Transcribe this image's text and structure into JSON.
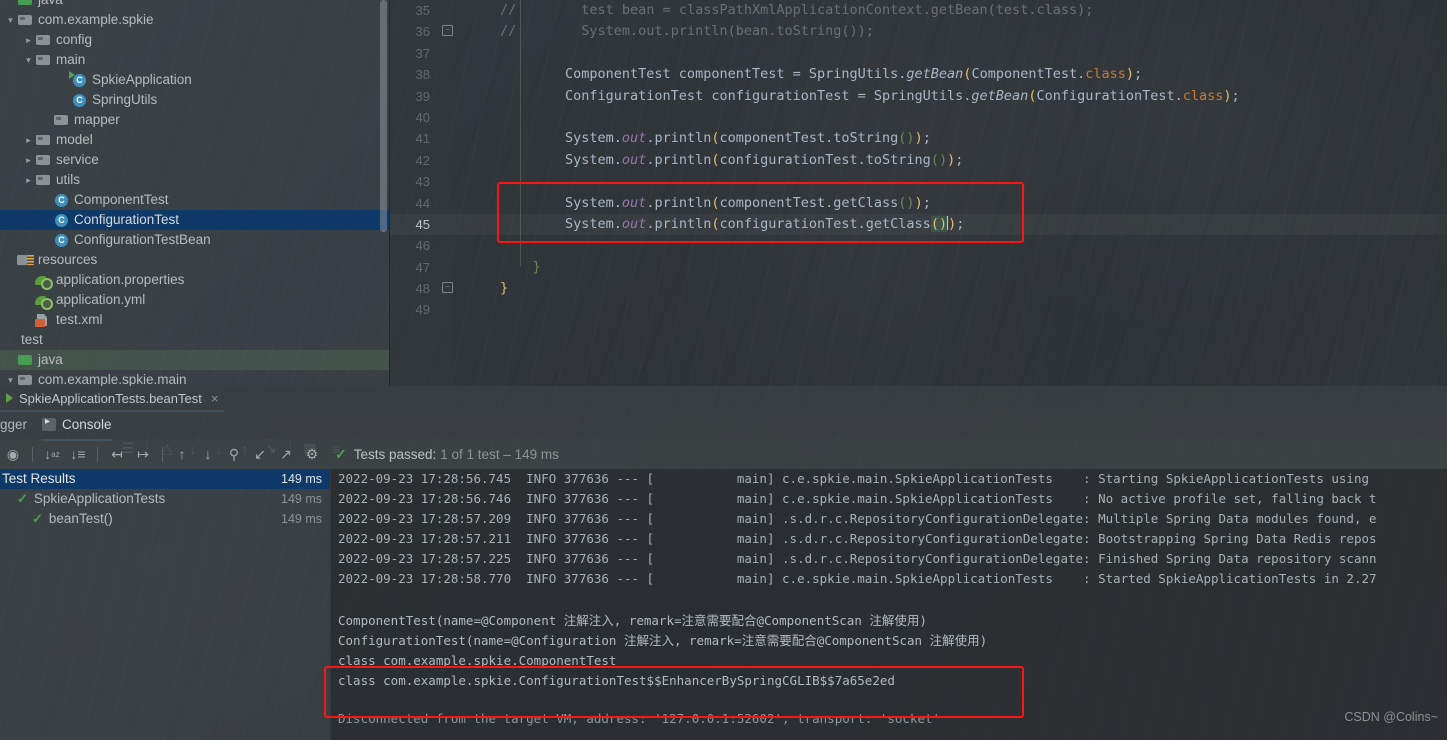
{
  "app": {
    "ide": "IntelliJ IDEA",
    "watermark": "CSDN @Colins~"
  },
  "project_tree": {
    "items": [
      {
        "label": "java",
        "indent": 0,
        "arrow": "none",
        "icon": "folder-green-icon",
        "state": "clipped"
      },
      {
        "label": "com.example.spkie",
        "indent": 0,
        "arrow": "down",
        "icon": "package-icon",
        "state": "normal"
      },
      {
        "label": "config",
        "indent": 1,
        "arrow": "right",
        "icon": "package-icon",
        "state": "normal"
      },
      {
        "label": "main",
        "indent": 1,
        "arrow": "down",
        "icon": "package-icon",
        "state": "normal"
      },
      {
        "label": "SpkieApplication",
        "indent": 3,
        "arrow": "none",
        "icon": "java-class-run-icon",
        "state": "normal"
      },
      {
        "label": "SpringUtils",
        "indent": 3,
        "arrow": "none",
        "icon": "java-class-icon",
        "state": "normal"
      },
      {
        "label": "mapper",
        "indent": 2,
        "arrow": "none",
        "icon": "package-icon",
        "state": "normal"
      },
      {
        "label": "model",
        "indent": 1,
        "arrow": "right",
        "icon": "package-icon",
        "state": "normal"
      },
      {
        "label": "service",
        "indent": 1,
        "arrow": "right",
        "icon": "package-icon",
        "state": "normal"
      },
      {
        "label": "utils",
        "indent": 1,
        "arrow": "right",
        "icon": "package-icon",
        "state": "normal"
      },
      {
        "label": "ComponentTest",
        "indent": 2,
        "arrow": "none",
        "icon": "java-class-icon",
        "state": "normal"
      },
      {
        "label": "ConfigurationTest",
        "indent": 2,
        "arrow": "none",
        "icon": "java-class-icon",
        "state": "selected"
      },
      {
        "label": "ConfigurationTestBean",
        "indent": 2,
        "arrow": "none",
        "icon": "java-class-icon",
        "state": "normal"
      },
      {
        "label": "resources",
        "indent": 0,
        "arrow": "none",
        "icon": "resources-folder-icon",
        "state": "normal"
      },
      {
        "label": "application.properties",
        "indent": 1,
        "arrow": "none",
        "icon": "spring-properties-icon",
        "state": "normal"
      },
      {
        "label": "application.yml",
        "indent": 1,
        "arrow": "none",
        "icon": "spring-yaml-icon",
        "state": "normal"
      },
      {
        "label": "test.xml",
        "indent": 1,
        "arrow": "none",
        "icon": "xml-file-icon",
        "state": "normal"
      },
      {
        "label": "test",
        "indent": 0,
        "arrow": "none",
        "icon": "none",
        "state": "normal"
      },
      {
        "label": "java",
        "indent": 0,
        "arrow": "none",
        "icon": "folder-green-icon",
        "state": "highlight"
      },
      {
        "label": "com.example.spkie.main",
        "indent": 0,
        "arrow": "down",
        "icon": "package-icon",
        "state": "normal"
      }
    ]
  },
  "editor": {
    "first_line_number": 35,
    "current_line_number": 45,
    "lines": [
      {
        "num": 35,
        "tokens": [
          {
            "t": "//",
            "c": "comment"
          },
          {
            "t": "        test bean = classPathXmlApplicationContext.getBean(test.class);",
            "c": "comment"
          }
        ]
      },
      {
        "num": 36,
        "tokens": [
          {
            "t": "//",
            "c": "comment"
          },
          {
            "t": "        System.out.println(bean.toString());",
            "c": "comment"
          }
        ]
      },
      {
        "num": 37,
        "tokens": []
      },
      {
        "num": 38,
        "tokens": [
          {
            "t": "        ComponentTest componentTest = SpringUtils.",
            "c": "plain"
          },
          {
            "t": "getBean",
            "c": "method-italic"
          },
          {
            "t": "(",
            "c": "paren-y"
          },
          {
            "t": "ComponentTest.",
            "c": "plain"
          },
          {
            "t": "class",
            "c": "kw"
          },
          {
            "t": ")",
            "c": "paren-y"
          },
          {
            "t": ";",
            "c": "plain"
          }
        ]
      },
      {
        "num": 39,
        "tokens": [
          {
            "t": "        ConfigurationTest configurationTest = SpringUtils.",
            "c": "plain"
          },
          {
            "t": "getBean",
            "c": "method-italic"
          },
          {
            "t": "(",
            "c": "paren-y"
          },
          {
            "t": "ConfigurationTest.",
            "c": "plain"
          },
          {
            "t": "class",
            "c": "kw"
          },
          {
            "t": ")",
            "c": "paren-y"
          },
          {
            "t": ";",
            "c": "plain"
          }
        ]
      },
      {
        "num": 40,
        "tokens": []
      },
      {
        "num": 41,
        "tokens": [
          {
            "t": "        System.",
            "c": "plain"
          },
          {
            "t": "out",
            "c": "static"
          },
          {
            "t": ".println",
            "c": "plain"
          },
          {
            "t": "(",
            "c": "paren-y"
          },
          {
            "t": "componentTest.toString",
            "c": "plain"
          },
          {
            "t": "()",
            "c": "paren-g"
          },
          {
            "t": ")",
            "c": "paren-y"
          },
          {
            "t": ";",
            "c": "plain"
          }
        ]
      },
      {
        "num": 42,
        "tokens": [
          {
            "t": "        System.",
            "c": "plain"
          },
          {
            "t": "out",
            "c": "static"
          },
          {
            "t": ".println",
            "c": "plain"
          },
          {
            "t": "(",
            "c": "paren-y"
          },
          {
            "t": "configurationTest.toString",
            "c": "plain"
          },
          {
            "t": "()",
            "c": "paren-g"
          },
          {
            "t": ")",
            "c": "paren-y"
          },
          {
            "t": ";",
            "c": "plain"
          }
        ]
      },
      {
        "num": 43,
        "tokens": []
      },
      {
        "num": 44,
        "tokens": [
          {
            "t": "        System.",
            "c": "plain"
          },
          {
            "t": "out",
            "c": "static"
          },
          {
            "t": ".println",
            "c": "plain"
          },
          {
            "t": "(",
            "c": "paren-y"
          },
          {
            "t": "componentTest.getClass",
            "c": "plain"
          },
          {
            "t": "()",
            "c": "paren-g"
          },
          {
            "t": ")",
            "c": "paren-y"
          },
          {
            "t": ";",
            "c": "plain"
          }
        ]
      },
      {
        "num": 45,
        "tokens": [
          {
            "t": "        System.",
            "c": "plain"
          },
          {
            "t": "out",
            "c": "static"
          },
          {
            "t": ".println",
            "c": "plain"
          },
          {
            "t": "(",
            "c": "paren-y"
          },
          {
            "t": "configurationTest.getClass",
            "c": "plain"
          },
          {
            "t": "()",
            "c": "paren-y-hl"
          },
          {
            "t": "|",
            "c": "caret"
          },
          {
            "t": ")",
            "c": "paren-y"
          },
          {
            "t": ";",
            "c": "plain"
          }
        ]
      },
      {
        "num": 46,
        "tokens": []
      },
      {
        "num": 47,
        "tokens": [
          {
            "t": "    }",
            "c": "brace-g"
          }
        ]
      },
      {
        "num": 48,
        "tokens": [
          {
            "t": "}",
            "c": "brace"
          }
        ]
      },
      {
        "num": 49,
        "tokens": []
      }
    ],
    "highlight_box": {
      "label": "red-annotation-box",
      "color": "#fb1616"
    }
  },
  "run_window": {
    "tab": {
      "title": "SpkieApplicationTests.beanTest",
      "close_label": "×"
    },
    "left_tab_partial": "gger",
    "console_tab": "Console",
    "toolbar_icons": [
      "wrap-text-icon",
      "soft-wrap-icon",
      "scroll-up-icon",
      "scroll-down-icon",
      "export-icon",
      "print-icon",
      "jump-to-end-icon",
      "table-view-icon",
      "settings-list-icon"
    ],
    "toolbar2_icons": [
      "sort-alphabetically-icon",
      "sort-by-duration-icon",
      "expand-all-icon",
      "collapse-all-icon",
      "previous-icon",
      "next-icon",
      "search-history-icon",
      "import-test-icon",
      "export-test-icon",
      "settings-gear-icon"
    ],
    "tests_status": {
      "icon": "check-icon",
      "prefix": "Tests passed:",
      "detail": "1 of 1 test – 149 ms"
    },
    "test_results": {
      "rows": [
        {
          "label": "Test Results",
          "time": "149 ms",
          "indent": 0,
          "checked": false,
          "selected": true
        },
        {
          "label": "SpkieApplicationTests",
          "time": "149 ms",
          "indent": 1,
          "checked": true,
          "selected": false
        },
        {
          "label": "beanTest()",
          "time": "149 ms",
          "indent": 2,
          "checked": true,
          "selected": false
        }
      ]
    },
    "console": {
      "log_lines": [
        {
          "ts": "2022-09-23 17:28:56.745",
          "level": "INFO",
          "pid": "377636",
          "sep": "---",
          "thread": "main",
          "logger": "c.e.spkie.main.SpkieApplicationTests",
          "msg": "Starting SpkieApplicationTests using"
        },
        {
          "ts": "2022-09-23 17:28:56.746",
          "level": "INFO",
          "pid": "377636",
          "sep": "---",
          "thread": "main",
          "logger": "c.e.spkie.main.SpkieApplicationTests",
          "msg": "No active profile set, falling back t"
        },
        {
          "ts": "2022-09-23 17:28:57.209",
          "level": "INFO",
          "pid": "377636",
          "sep": "---",
          "thread": "main",
          "logger": ".s.d.r.c.RepositoryConfigurationDelegate",
          "msg": "Multiple Spring Data modules found, e"
        },
        {
          "ts": "2022-09-23 17:28:57.211",
          "level": "INFO",
          "pid": "377636",
          "sep": "---",
          "thread": "main",
          "logger": ".s.d.r.c.RepositoryConfigurationDelegate",
          "msg": "Bootstrapping Spring Data Redis repos"
        },
        {
          "ts": "2022-09-23 17:28:57.225",
          "level": "INFO",
          "pid": "377636",
          "sep": "---",
          "thread": "main",
          "logger": ".s.d.r.c.RepositoryConfigurationDelegate",
          "msg": "Finished Spring Data repository scann"
        },
        {
          "ts": "2022-09-23 17:28:58.770",
          "level": "INFO",
          "pid": "377636",
          "sep": "---",
          "thread": "main",
          "logger": "c.e.spkie.main.SpkieApplicationTests",
          "msg": "Started SpkieApplicationTests in 2.27"
        }
      ],
      "output_lines": [
        "ComponentTest(name=@Component 注解注入, remark=注意需要配合@ComponentScan 注解使用)",
        "ConfigurationTest(name=@Configuration 注解注入, remark=注意需要配合@ComponentScan 注解使用)",
        "class com.example.spkie.ComponentTest",
        "class com.example.spkie.ConfigurationTest$$EnhancerBySpringCGLIB$$7a65e2ed"
      ],
      "tail_line": "Disconnected from the target VM, address: '127.0.0.1:52602', transport: 'socket'",
      "highlight_box": {
        "label": "red-annotation-box",
        "color": "#fb1616"
      }
    }
  }
}
